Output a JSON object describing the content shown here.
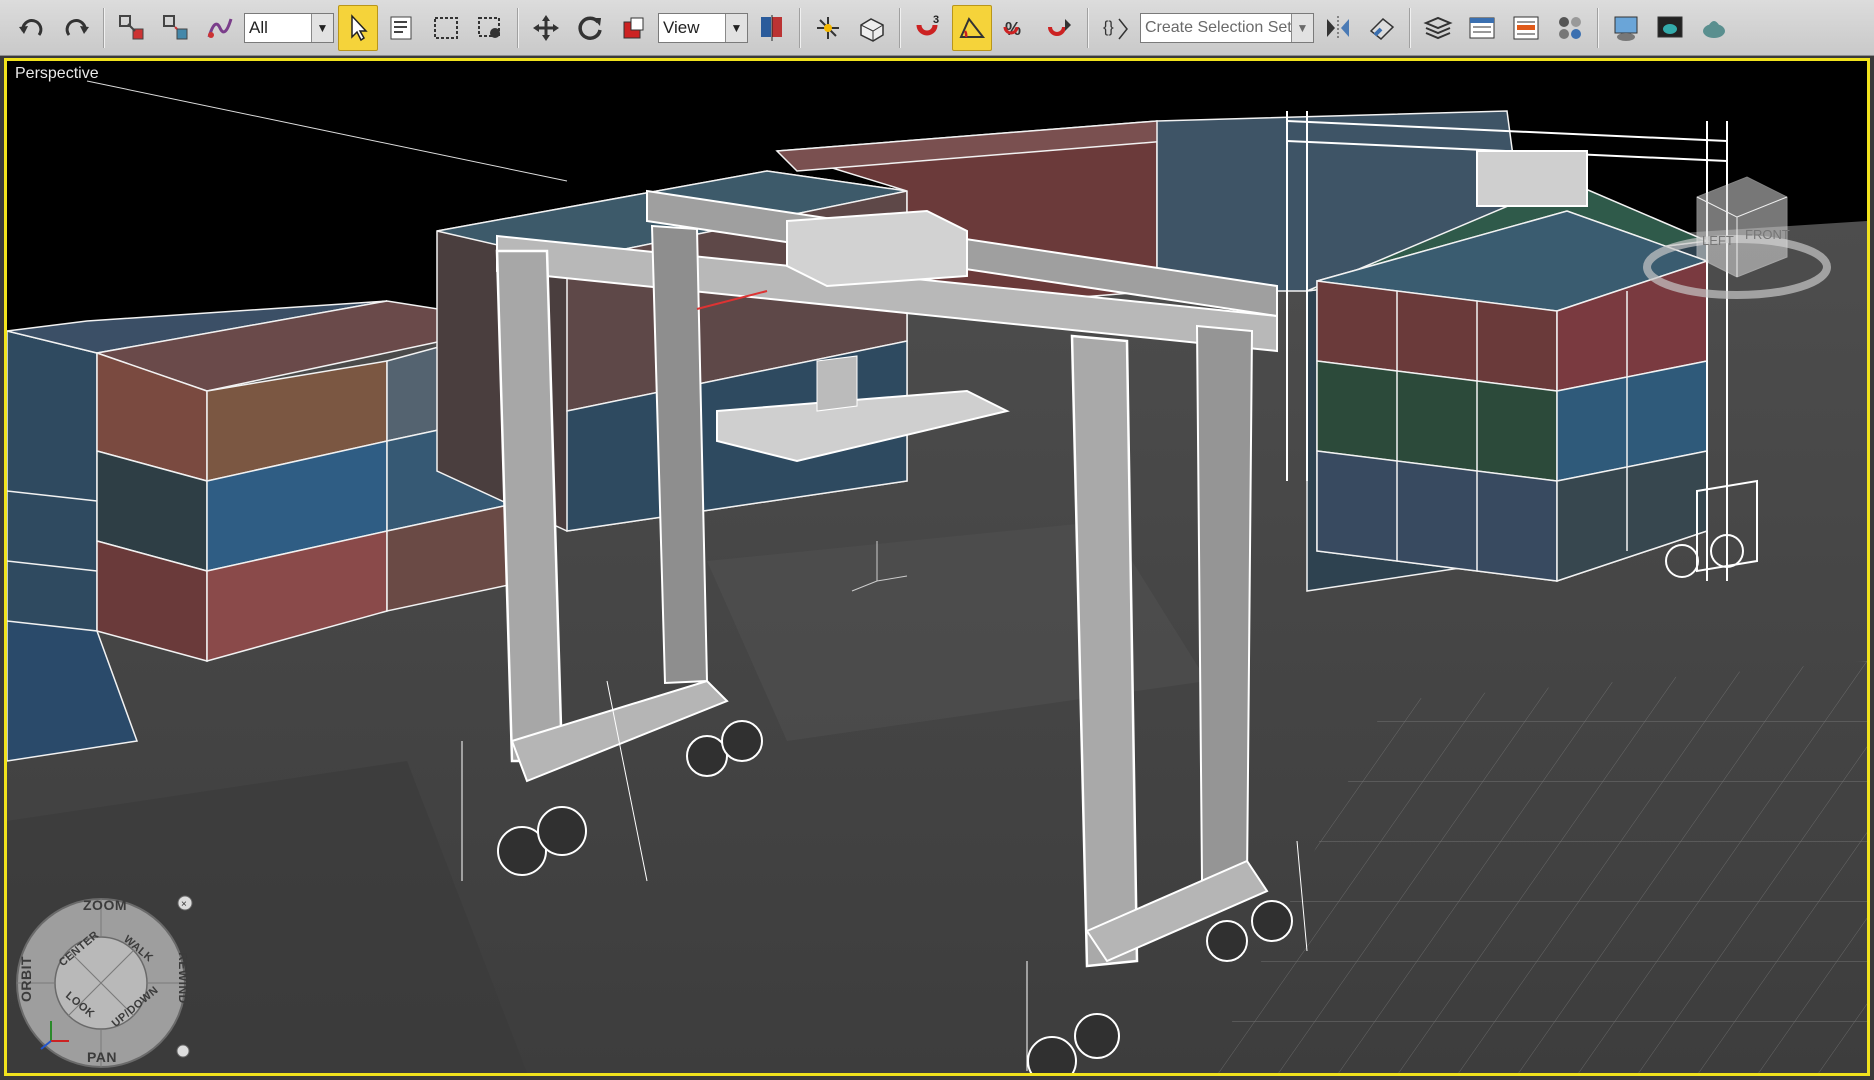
{
  "toolbar": {
    "selection_filter": "All",
    "reference_coord": "View",
    "named_selection_placeholder": "Create Selection Set",
    "snap_angle_label": "3",
    "buttons": [
      {
        "name": "undo-icon"
      },
      {
        "name": "redo-icon"
      },
      {
        "name": "select-and-link-icon"
      },
      {
        "name": "unlink-selection-icon"
      },
      {
        "name": "bind-to-space-warp-icon"
      },
      {
        "name": "select-object-icon"
      },
      {
        "name": "select-by-name-icon"
      },
      {
        "name": "rectangular-selection-region-icon"
      },
      {
        "name": "window-crossing-icon"
      },
      {
        "name": "select-and-move-icon"
      },
      {
        "name": "select-and-rotate-icon"
      },
      {
        "name": "select-and-scale-icon"
      },
      {
        "name": "use-pivot-center-icon"
      },
      {
        "name": "select-and-manipulate-icon"
      },
      {
        "name": "keyboard-shortcut-override-icon"
      },
      {
        "name": "snaps-toggle-icon"
      },
      {
        "name": "angle-snap-icon"
      },
      {
        "name": "percent-snap-icon"
      },
      {
        "name": "spinner-snap-icon"
      },
      {
        "name": "edit-named-selection-icon"
      },
      {
        "name": "mirror-icon"
      },
      {
        "name": "align-icon"
      },
      {
        "name": "layer-manager-icon"
      },
      {
        "name": "graphite-modeling-tools-icon"
      },
      {
        "name": "curve-editor-icon"
      },
      {
        "name": "schematic-view-icon"
      },
      {
        "name": "material-editor-icon"
      },
      {
        "name": "render-setup-icon"
      },
      {
        "name": "rendered-frame-window-icon"
      },
      {
        "name": "render-production-icon"
      }
    ]
  },
  "viewport": {
    "label": "Perspective",
    "border_color": "#f1e21d"
  },
  "steering_wheel": {
    "zoom": "ZOOM",
    "orbit": "ORBIT",
    "pan": "PAN",
    "rewind": "REWIND",
    "center": "CENTER",
    "walk": "WALK",
    "look": "LOOK",
    "updown": "UP/DOWN"
  },
  "viewcube": {
    "left_face": "LEFT",
    "front_face": "FRONT"
  }
}
